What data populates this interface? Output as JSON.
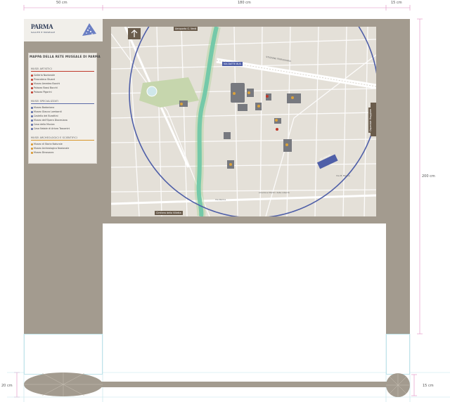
{
  "dimensions": {
    "left_width": "50 cm",
    "center_width": "180 cm",
    "right_width": "15 cm",
    "height": "200 cm",
    "base_left_depth": "20 cm",
    "base_right_depth": "15 cm"
  },
  "logo": {
    "name": "PARMA",
    "subtitle": "SALUTE E MUSEALE"
  },
  "legend": {
    "title": "MAPPA DELLA RETE MUSEALE DI PARMA",
    "sections": [
      {
        "title": "MUSEI ARTISTICI",
        "color": "#c0392b",
        "items": [
          "Galleria Nazionale",
          "Pinacoteca Stuard",
          "Museo Amedeo Bocchi",
          "Palazzo Bossi Bocchi",
          "Palazzo Pigorini"
        ]
      },
      {
        "title": "MUSEI SPECIALIZZATI",
        "color": "#5a6aa8",
        "items": [
          "Museo Bodoniano",
          "Museo Glauco Lombardi",
          "Castello dei Burattini",
          "Museo dell'Opera Diocesiana",
          "Casa della Musica",
          "Casa Natale di Arturo Toscanini"
        ]
      },
      {
        "title": "MUSEI ARCHEOLOGICI E SCIENTIFICI",
        "color": "#d8952a",
        "items": [
          "Museo di Storia Naturale",
          "Museo Archeologico Nazionale",
          "Museo Dinosauro"
        ]
      }
    ]
  },
  "map": {
    "signs": {
      "airport": "Aeroporto G. Verdi",
      "station": "VIA DATTE BUS",
      "cemetery": "Cimitero della Villetta",
      "hospital": "Ospedale Maggiore",
      "walk": "20 minuti"
    },
    "streets": [
      "STAZIONE FERROVIARIA",
      "stradone Martiri della Libertà",
      "Via M. Barilla",
      "Via Parma"
    ]
  }
}
